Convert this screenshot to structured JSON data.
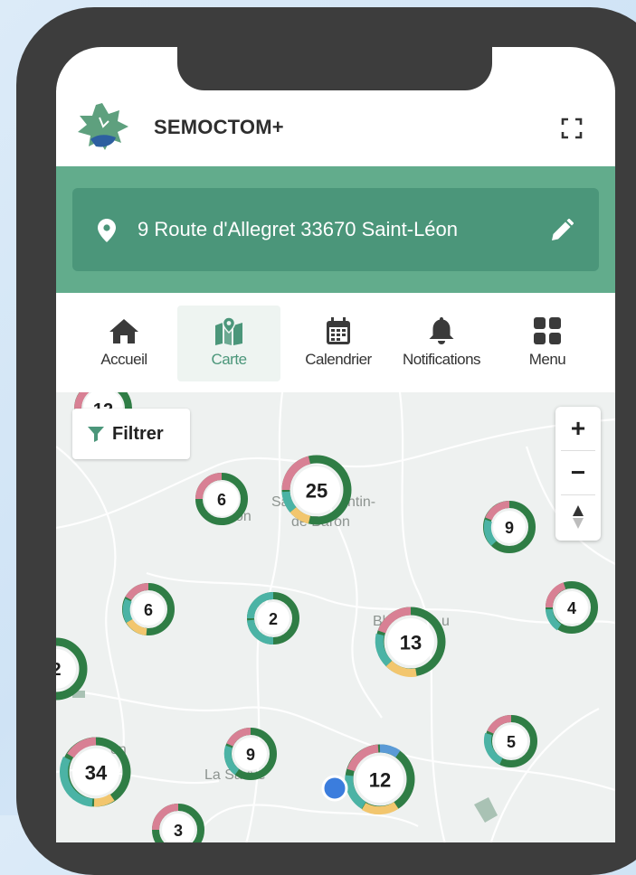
{
  "app": {
    "title": "SEMOCTOM+"
  },
  "address": {
    "text": "9 Route d'Allegret 33670 Saint-Léon"
  },
  "tabs": [
    {
      "label": "Accueil",
      "icon": "home-icon",
      "active": false
    },
    {
      "label": "Carte",
      "icon": "map-icon",
      "active": true
    },
    {
      "label": "Calendrier",
      "icon": "calendar-icon",
      "active": false
    },
    {
      "label": "Notifications",
      "icon": "bell-icon",
      "active": false
    },
    {
      "label": "Menu",
      "icon": "grid-icon",
      "active": false
    }
  ],
  "map": {
    "filter_label": "Filtrer",
    "zoom_in_label": "+",
    "zoom_out_label": "−",
    "place_labels": [
      "on",
      "Sa",
      "ntin-",
      "de Baron",
      "Bl",
      "u",
      "on",
      "La Sauve"
    ],
    "clusters": [
      {
        "count": "12"
      },
      {
        "count": "6"
      },
      {
        "count": "25"
      },
      {
        "count": "9"
      },
      {
        "count": "4"
      },
      {
        "count": "6"
      },
      {
        "count": "2"
      },
      {
        "count": "13"
      },
      {
        "count": "2"
      },
      {
        "count": "34"
      },
      {
        "count": "9"
      },
      {
        "count": "12"
      },
      {
        "count": "5"
      },
      {
        "count": "3"
      }
    ]
  },
  "colors": {
    "brand_green": "#62ac8c",
    "brand_green_dark": "#4b967a",
    "cluster_dark_green": "#2f7d45",
    "cluster_teal": "#4bb3a5",
    "cluster_pink": "#d88094",
    "cluster_yellow": "#f2c66e",
    "cluster_blue": "#5a9ad6",
    "location_dot": "#3b7ddd"
  }
}
